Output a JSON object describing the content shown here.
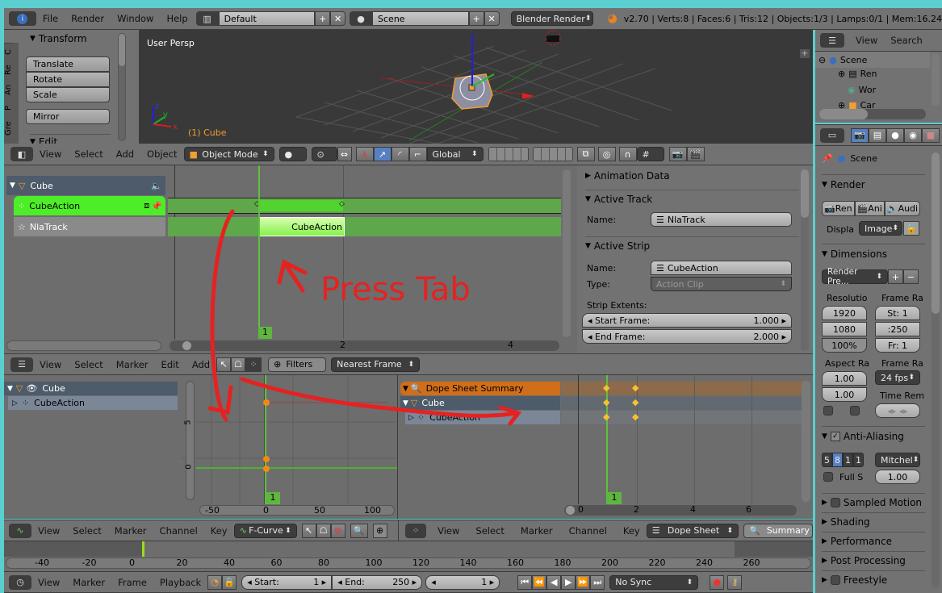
{
  "info_header": {
    "menus": [
      "File",
      "Render",
      "Window",
      "Help"
    ],
    "layout": "Default",
    "scene": "Scene",
    "engine": "Blender Render",
    "stats": "v2.70 | Verts:8 | Faces:6 | Tris:12 | Objects:1/3 | Lamps:0/1 | Mem:16.24"
  },
  "tool_shelf": {
    "tabs": [
      "C",
      "Re",
      "An",
      "P",
      "Gre"
    ],
    "transform_title": "Transform",
    "buttons": [
      "Translate",
      "Rotate",
      "Scale"
    ],
    "mirror": "Mirror",
    "edit_title": "Edit"
  },
  "viewport": {
    "view_label": "User Persp",
    "object_label": "(1) Cube",
    "colors": {
      "x_axis": "#d02020",
      "y_axis": "#20b020",
      "z_axis": "#2020e0",
      "selected": "#f19d2b"
    }
  },
  "view3d_header": {
    "menus": [
      "View",
      "Select",
      "Add",
      "Object"
    ],
    "mode": "Object Mode",
    "orientation": "Global"
  },
  "outliner": {
    "menus": [
      "View",
      "Search"
    ],
    "items": [
      {
        "label": "Scene"
      },
      {
        "label": "Ren"
      },
      {
        "label": "Wor"
      },
      {
        "label": "Car"
      }
    ]
  },
  "properties": {
    "scene_label": "Scene",
    "render_title": "Render",
    "render_buttons": [
      "Ren",
      "Ani",
      "Audi"
    ],
    "display_label": "Displa",
    "display_value": "Image",
    "dimensions_title": "Dimensions",
    "render_presets": "Render Pre...",
    "resolution_label": "Resolutio",
    "res_x": "1920",
    "res_y": "1080",
    "res_pct": "100%",
    "frame_range_label": "Frame Ra",
    "frame_start": "St: 1",
    "frame_end": ":250",
    "frame_step": "Fr: 1",
    "aspect_label": "Aspect Ra",
    "aspect_x": "1.00",
    "aspect_y": "1.00",
    "frame_rate_label": "Frame Ra",
    "fps": "24 fps",
    "time_remap_label": "Time Rem",
    "aa_title": "Anti-Aliasing",
    "aa_samples": [
      "5",
      "8",
      "1",
      "1"
    ],
    "aa_filter": "Mitchel",
    "full_sample": "Full S",
    "filter_size": "1.00",
    "collapsed_panels": [
      "Sampled Motion",
      "Shading",
      "Performance",
      "Post Processing",
      "Freestyle"
    ]
  },
  "nla": {
    "channels": [
      {
        "label": "Cube"
      },
      {
        "label": "CubeAction"
      },
      {
        "label": "NlaTrack"
      }
    ],
    "strip_label": "CubeAction",
    "current_frame": "1",
    "ticks": [
      "2",
      "4"
    ],
    "sidebar": {
      "animation_data": "Animation Data",
      "active_track": "Active Track",
      "name_label": "Name:",
      "track_name": "NlaTrack",
      "active_strip": "Active Strip",
      "strip_name": "CubeAction",
      "type_label": "Type:",
      "type_value": "Action Clip",
      "extents_label": "Strip Extents:",
      "start_label": "Start Frame:",
      "start_value": "1.000",
      "end_label": "End Frame:",
      "end_value": "2.000"
    }
  },
  "nla_header": {
    "menus": [
      "View",
      "Select",
      "Marker",
      "Edit",
      "Add"
    ],
    "filters": "Filters",
    "snap": "Nearest Frame"
  },
  "annotation": {
    "text": "Press Tab",
    "color": "#e52222"
  },
  "graph": {
    "channels": [
      {
        "label": "Cube"
      },
      {
        "label": "CubeAction"
      }
    ],
    "x_ticks": [
      "-50",
      "0",
      "50",
      "100"
    ],
    "y_ticks": [
      "5",
      "0"
    ],
    "current_frame": "1"
  },
  "graph_header": {
    "menus": [
      "View",
      "Select",
      "Marker",
      "Channel",
      "Key"
    ],
    "mode": "F-Curve"
  },
  "dopesheet": {
    "channels": [
      {
        "label": "Dope Sheet Summary"
      },
      {
        "label": "Cube"
      },
      {
        "label": "CubeAction"
      }
    ],
    "x_ticks": [
      "0",
      "2",
      "4",
      "6"
    ],
    "current_frame": "1"
  },
  "dopesheet_header": {
    "menus": [
      "View",
      "Select",
      "Marker",
      "Channel",
      "Key"
    ],
    "mode": "Dope Sheet",
    "summary": "Summary"
  },
  "timeline": {
    "ticks": [
      "-40",
      "-20",
      "0",
      "20",
      "40",
      "60",
      "80",
      "100",
      "120",
      "140",
      "160",
      "180",
      "200",
      "220",
      "240",
      "260"
    ]
  },
  "timeline_header": {
    "menus": [
      "View",
      "Marker",
      "Frame",
      "Playback"
    ],
    "start_label": "Start:",
    "start_value": "1",
    "end_label": "End:",
    "end_value": "250",
    "current": "1",
    "sync": "No Sync"
  }
}
